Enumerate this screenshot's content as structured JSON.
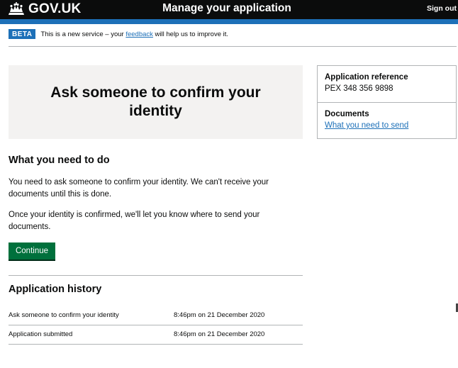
{
  "header": {
    "logo_text": "GOV.UK",
    "service_name": "Manage your application",
    "sign_out": "Sign out"
  },
  "phase_banner": {
    "tag": "BETA",
    "text_before": "This is a new service – your ",
    "link": "feedback",
    "text_after": " will help us to improve it."
  },
  "panel": {
    "title": "Ask someone to confirm your identity"
  },
  "sidebar": {
    "reference_label": "Application reference",
    "reference_value": "PEX 348 356 9898",
    "documents_label": "Documents",
    "documents_link": "What you need to send"
  },
  "todo": {
    "heading": "What you need to do",
    "para1": "You need to ask someone to confirm your identity. We can't receive your documents until this is done.",
    "para2": "Once your identity is confirmed, we'll let you know where to send your documents.",
    "continue_label": "Continue"
  },
  "history": {
    "heading": "Application history",
    "rows": [
      {
        "event": "Ask someone to confirm your identity",
        "time": "8:46pm on 21 December 2020"
      },
      {
        "event": "Application submitted",
        "time": "8:46pm on 21 December 2020"
      }
    ]
  },
  "colors": {
    "header_bg": "#0b0c0c",
    "brand_blue": "#1d70b8",
    "button_green": "#00703c",
    "panel_grey": "#f3f2f1"
  }
}
